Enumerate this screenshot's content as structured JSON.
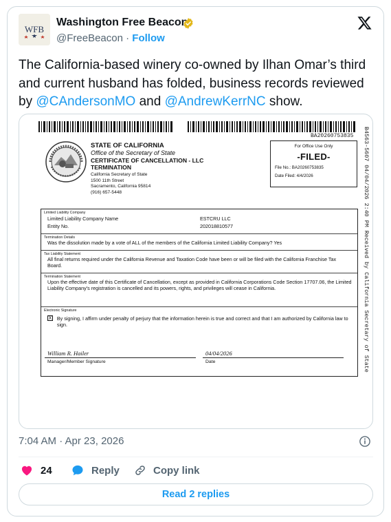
{
  "author": {
    "avatar_text": "WFB",
    "name": "Washington Free Beacon",
    "handle": "@FreeBeacon",
    "separator": "·",
    "follow_label": "Follow"
  },
  "tweet": {
    "text_1": "The California-based winery co-owned by Ilhan Omar’s third and current husband has folded, business records reviewed by ",
    "mention_1": "@CAndersonMO",
    "text_2": " and ",
    "mention_2": "@AndrewKerrNC",
    "text_3": " show."
  },
  "document": {
    "doc_id": "BA20260753835",
    "vertical_stamp": "B4563-5607 04/04/2026 2:40 PM Received by California Secretary of State",
    "state_title": "STATE OF CALIFORNIA",
    "office": "Office of the Secretary of State",
    "cert_title": "CERTIFICATE OF CANCELLATION - LLC TERMINATION",
    "addr_1": "California Secretary of State",
    "addr_2": "1500 11th Street",
    "addr_3": "Sacramento, California 95814",
    "addr_4": "(916) 657-5448",
    "office_use": "For Office Use Only",
    "filed": "-FILED-",
    "file_no": "File No.: BA20260753835",
    "date_filed": "Date Filed: 4/4/2026",
    "llc_label": "Limited Liability Company",
    "llc_name_key": "Limited Liability Company Name",
    "llc_name_val": "ESTCRU LLC",
    "entity_key": "Entity No.",
    "entity_val": "202018810577",
    "term_label": "Termination Details",
    "term_text": "Was the dissolution made by a vote of ALL of the members of the California Limited Liability Company?  Yes",
    "tax_label": "Tax Liability Statement",
    "tax_text": "All final returns required under the California Revenue and Taxation Code have been or will be filed with the California Franchise Tax Board.",
    "stmt_label": "Termination Statement",
    "stmt_text": "Upon the effective date of this Certificate of Cancellation, except as provided in California Corporations Code Section 17707.06, the Limited Liability Company's registration is cancelled and its powers, rights, and privileges will cease in California.",
    "esig_label": "Electronic Signature",
    "checkbox_mark": "X",
    "esig_text": "By signing, I affirm under penalty of perjury that the information herein is true and correct and that I am authorized by California law to sign.",
    "signer": "William R. Hailer",
    "signer_caption": "Manager/Member Signature",
    "sig_date": "04/04/2026",
    "date_caption": "Date"
  },
  "footer": {
    "timestamp": "7:04 AM · Apr 23, 2026",
    "like_count": "24",
    "reply_label": "Reply",
    "copy_link_label": "Copy link",
    "read_replies_label": "Read 2 replies"
  },
  "colors": {
    "accent": "#1d9bf0",
    "like": "#f91880",
    "verified_gold": "#e2b719",
    "muted": "#536471"
  }
}
